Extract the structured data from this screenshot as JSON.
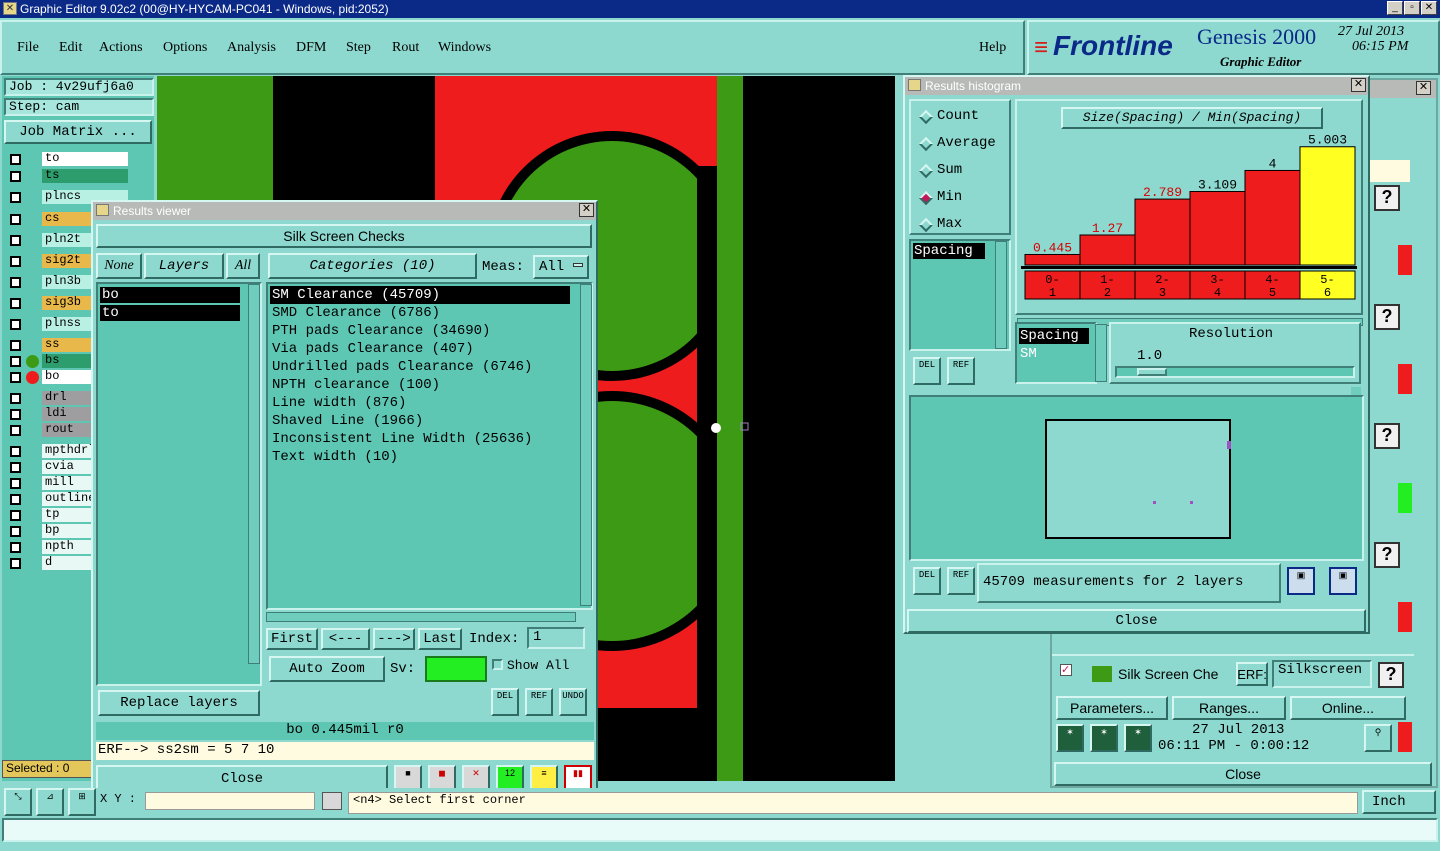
{
  "window": {
    "title": "Graphic Editor 9.02c2 (00@HY-HYCAM-PC041 - Windows, pid:2052)"
  },
  "menu": [
    "File",
    "Edit",
    "Actions",
    "Options",
    "Analysis",
    "DFM",
    "Step",
    "Rout",
    "Windows"
  ],
  "help": "Help",
  "brand": {
    "logo": "Frontline",
    "product": "Genesis 2000",
    "subtitle": "Graphic Editor",
    "date": "27 Jul 2013",
    "time": "06:15 PM"
  },
  "job": {
    "job": "Job : 4v29ufj6a0",
    "step": "Step: cam",
    "matrix_button": "Job Matrix ..."
  },
  "layers": [
    "to",
    "ts",
    "plncs",
    "cs",
    "pln2t",
    "sig2t",
    "pln3b",
    "sig3b",
    "plnss",
    "ss",
    "bs",
    "bo",
    "drl",
    "ldi",
    "rout",
    "mpthdrl",
    "cvia",
    "mill",
    "outline",
    "tp",
    "bp",
    "npth",
    "d"
  ],
  "selected_label": "Selected : 0",
  "results_viewer": {
    "title": "Results viewer",
    "header": "Silk Screen Checks",
    "none": "None",
    "layers": "Layers",
    "all": "All",
    "categories": "Categories (10)",
    "meas_label": "Meas:",
    "meas_value": "All",
    "layer_list": [
      "bo",
      "to"
    ],
    "category_list": [
      "SM Clearance (45709)",
      "SMD Clearance (6786)",
      "PTH pads Clearance (34690)",
      "Via pads Clearance (407)",
      "Undrilled pads Clearance (6746)",
      "NPTH clearance (100)",
      "Line width (876)",
      "Shaved Line (1966)",
      "Inconsistent Line Width (25636)",
      "Text width (10)"
    ],
    "first": "First",
    "prev": "<---",
    "next": "--->",
    "last": "Last",
    "index_label": "Index:",
    "index_value": "1",
    "auto_zoom": "Auto Zoom",
    "sv_label": "Sv:",
    "show_all": "Show All",
    "replace_layers": "Replace layers",
    "status": "bo 0.445mil  r0",
    "erf": "ERF--> ss2sm = 5 7 10",
    "close": "Close",
    "del": "DEL",
    "ref": "REF",
    "undo": "UNDO"
  },
  "histogram": {
    "title": "Results histogram",
    "options": [
      "Count",
      "Average",
      "Sum",
      "Min",
      "Max"
    ],
    "selected_option": "Min",
    "heading": "Size(Spacing) / Min(Spacing)",
    "field_item": "Spacing",
    "chart_data": {
      "type": "bar",
      "categories": [
        "0-1",
        "1-2",
        "2-3",
        "3-4",
        "4-5",
        "5-6"
      ],
      "values": [
        0.445,
        1.27,
        2.789,
        3.109,
        4,
        5.003
      ],
      "value_labels": [
        "0.445",
        "1.27",
        "2.789",
        "3.109",
        "4",
        "5.003"
      ],
      "colors": [
        "#ee1c1c",
        "#ee1c1c",
        "#ee1c1c",
        "#ee1c1c",
        "#ee1c1c",
        "#ffff22"
      ],
      "ylim": [
        0,
        5.5
      ]
    },
    "spacing_list": [
      "Spacing",
      "SM"
    ],
    "resolution_label": "Resolution",
    "resolution_value": "1.0",
    "measurements": "45709 measurements for 2 layers",
    "close": "Close",
    "del": "DEL",
    "ref": "REF"
  },
  "right_panel": {
    "check_name": "Silk Screen Che",
    "erf_label": "ERF:",
    "erf_value": "Silkscreen",
    "parameters": "Parameters...",
    "ranges": "Ranges...",
    "online": "Online...",
    "date": "27 Jul 2013",
    "time": "06:11 PM - 0:00:12",
    "close": "Close"
  },
  "statusbar": {
    "xy": "X Y :",
    "prompt": "<n4>  Select first corner",
    "unit": "Inch"
  }
}
